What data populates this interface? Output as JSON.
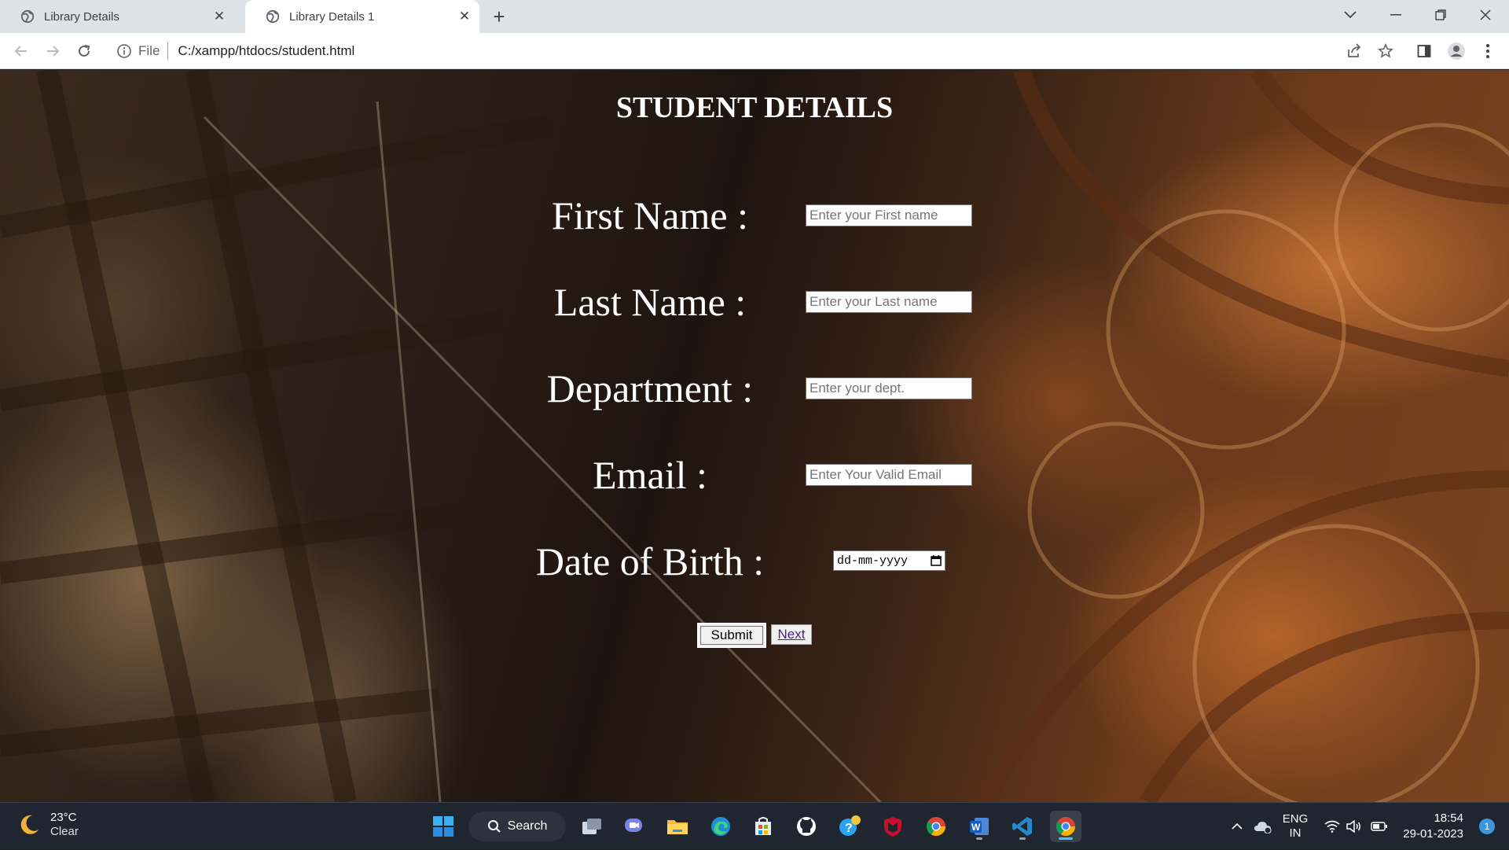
{
  "browser": {
    "tabs": [
      {
        "title": "Library Details",
        "active": false
      },
      {
        "title": "Library Details 1",
        "active": true
      }
    ],
    "address": {
      "scheme": "File",
      "url": "C:/xampp/htdocs/student.html"
    }
  },
  "page": {
    "heading": "STUDENT DETAILS",
    "fields": {
      "first_name": {
        "label": "First Name :",
        "placeholder": "Enter your First name"
      },
      "last_name": {
        "label": "Last Name :",
        "placeholder": "Enter your Last name"
      },
      "department": {
        "label": "Department :",
        "placeholder": "Enter your dept."
      },
      "email": {
        "label": "Email :",
        "placeholder": "Enter Your Valid Email"
      },
      "dob": {
        "label": "Date of Birth :",
        "placeholder": "dd-mm-yyyy"
      }
    },
    "submit_label": "Submit",
    "next_label": "Next"
  },
  "taskbar": {
    "weather": {
      "temp": "23°C",
      "condition": "Clear"
    },
    "search_label": "Search",
    "language": {
      "line1": "ENG",
      "line2": "IN"
    },
    "time": "18:54",
    "date": "29-01-2023",
    "notification_count": "1"
  },
  "colors": {
    "link": "#551a8b",
    "taskbar": "#1f2630",
    "tabstrip": "#dee1e6"
  }
}
